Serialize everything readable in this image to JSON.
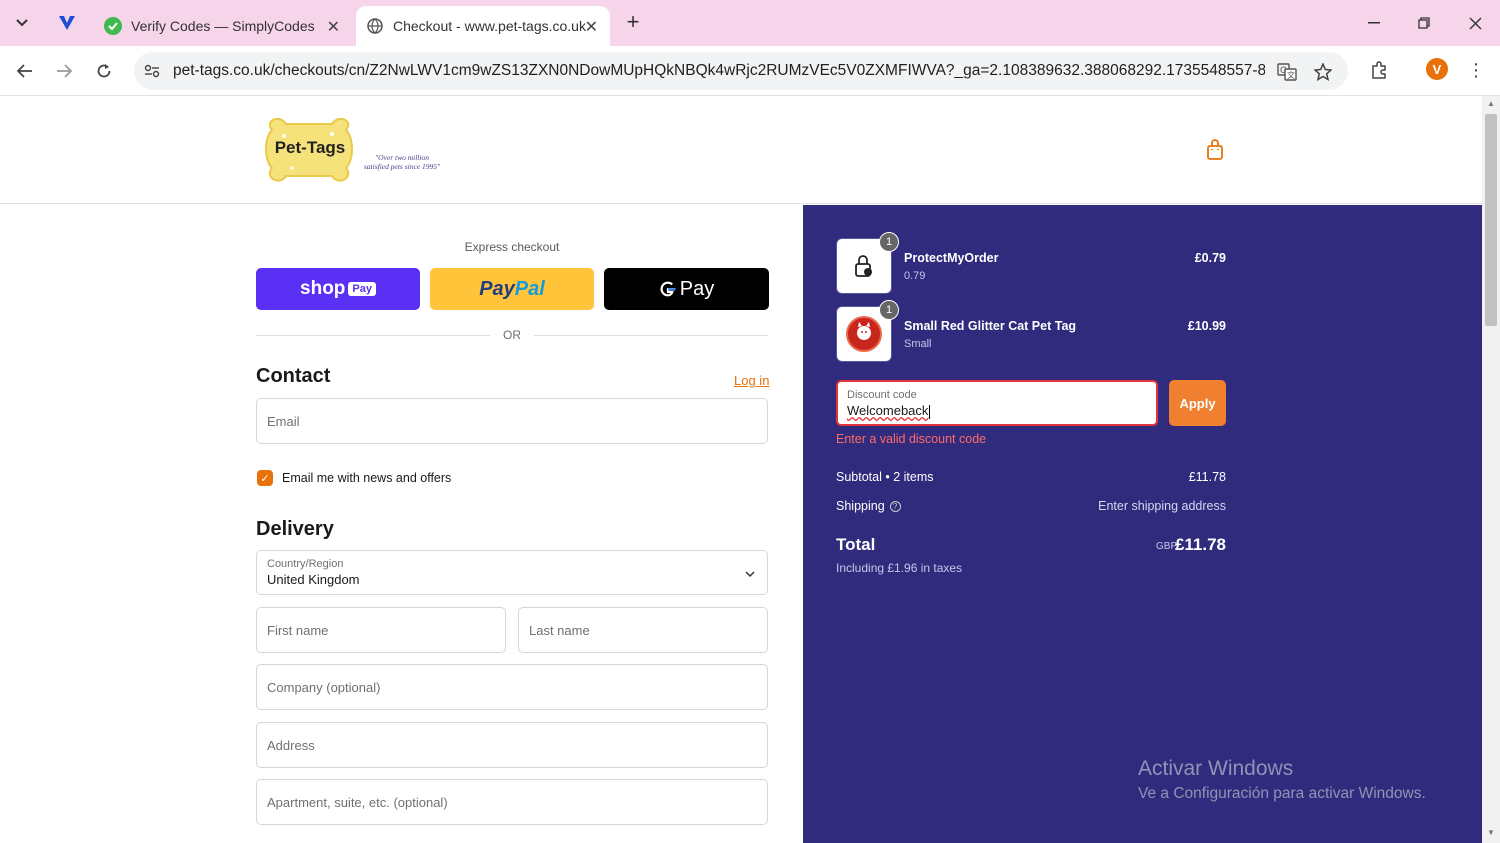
{
  "browser": {
    "tabs": [
      {
        "title": "Verify Codes — SimplyCodes",
        "active": false
      },
      {
        "title": "Checkout - www.pet-tags.co.uk",
        "active": true
      }
    ],
    "url": "pet-tags.co.uk/checkouts/cn/Z2NwLWV1cm9wZS13ZXN0NDowMUpHQkNBQk4wRjc2RUMzVEc5V0ZXMFIWVA?_ga=2.108389632.388068292.1735548557-8811...",
    "profile_initial": "V",
    "accent_color": "#f6d4ea"
  },
  "header": {
    "logo_text": "Pet-Tags",
    "logo_tagline": "\"Over two million satisfied pets since 1995\""
  },
  "express": {
    "label": "Express checkout",
    "shop_label": "shop",
    "shop_badge": "Pay",
    "paypal_part1": "Pay",
    "paypal_part2": "Pal",
    "gpay_label": "Pay",
    "or_text": "OR"
  },
  "contact": {
    "title": "Contact",
    "login_label": "Log in",
    "email_placeholder": "Email",
    "newsletter_label": "Email me with news and offers",
    "newsletter_checked": true
  },
  "delivery": {
    "title": "Delivery",
    "country_label": "Country/Region",
    "country_value": "United Kingdom",
    "first_name_placeholder": "First name",
    "last_name_placeholder": "Last name",
    "company_placeholder": "Company (optional)",
    "address_placeholder": "Address",
    "apartment_placeholder": "Apartment, suite, etc. (optional)"
  },
  "summary": {
    "items": [
      {
        "name": "ProtectMyOrder",
        "sub": "0.79",
        "price": "£0.79",
        "qty": "1",
        "icon": "lock-icon"
      },
      {
        "name": "Small Red Glitter Cat Pet Tag",
        "sub": "Small",
        "price": "£10.99",
        "qty": "1",
        "icon": "pet-tag-image"
      }
    ],
    "discount_label": "Discount code",
    "discount_value": "Welcomeback",
    "apply_label": "Apply",
    "discount_error": "Enter a valid discount code",
    "subtotal_label": "Subtotal • 2 items",
    "subtotal_value": "£11.78",
    "shipping_label": "Shipping",
    "shipping_value": "Enter shipping address",
    "total_label": "Total",
    "total_currency": "GBP",
    "total_value": "£11.78",
    "tax_note": "Including £1.96 in taxes",
    "bg_color": "#302b7c",
    "accent_color": "#f07f2f"
  },
  "watermark": {
    "line1": "Activar Windows",
    "line2": "Ve a Configuración para activar Windows."
  }
}
